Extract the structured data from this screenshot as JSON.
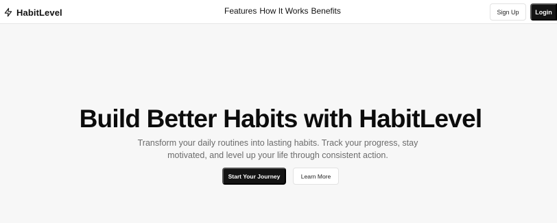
{
  "brand": {
    "name": "HabitLevel",
    "icon": "lightning-bolt-icon"
  },
  "nav": {
    "links": [
      "Features",
      "How It Works",
      "Benefits"
    ]
  },
  "auth": {
    "signup_label": "Sign Up",
    "login_label": "Login"
  },
  "hero": {
    "title": "Build Better Habits with HabitLevel",
    "subtitle": "Transform your daily routines into lasting habits. Track your progress, stay motivated, and level up your life through consistent action.",
    "primary_cta": "Start Your Journey",
    "secondary_cta": "Learn More"
  },
  "colors": {
    "background": "#f7f7f7",
    "primary_button": "#141414",
    "subtitle_text": "#6b6b6b"
  }
}
